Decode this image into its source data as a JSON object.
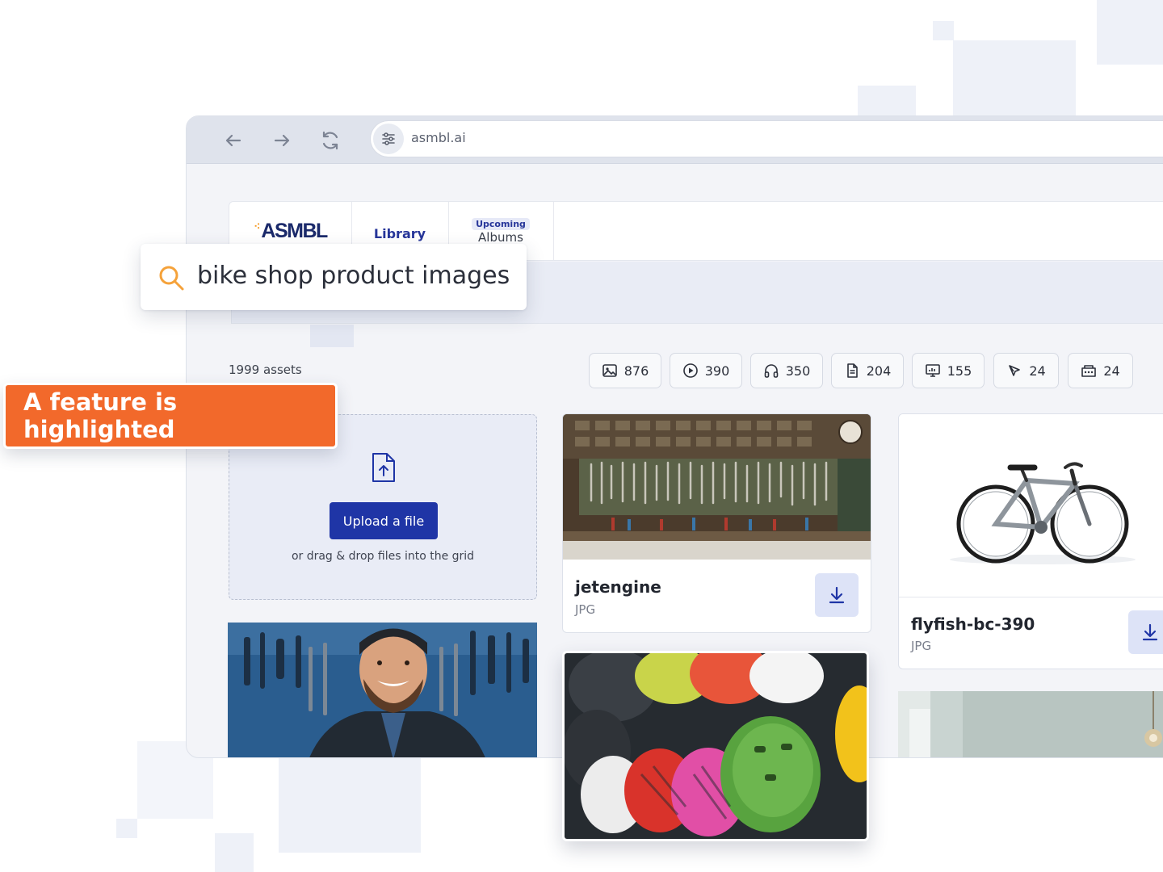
{
  "browser": {
    "url": "asmbl.ai",
    "nav_icons": [
      "back-arrow-icon",
      "forward-arrow-icon",
      "reload-icon",
      "site-settings-icon"
    ]
  },
  "app": {
    "logo": "ASMBL",
    "nav": {
      "library": "Library",
      "upcoming_badge": "Upcoming",
      "albums": "Albums"
    }
  },
  "search": {
    "query": "bike shop product images"
  },
  "assets": {
    "count_label": "1999 assets"
  },
  "filters": [
    {
      "icon": "image-icon",
      "count": "876"
    },
    {
      "icon": "video-icon",
      "count": "390"
    },
    {
      "icon": "audio-icon",
      "count": "350"
    },
    {
      "icon": "document-icon",
      "count": "204"
    },
    {
      "icon": "presentation-icon",
      "count": "155"
    },
    {
      "icon": "vector-icon",
      "count": "24"
    },
    {
      "icon": "other-icon",
      "count": "24"
    }
  ],
  "upload": {
    "button_label": "Upload a file",
    "hint": "or drag & drop files into the grid"
  },
  "cards": [
    {
      "title": "jetengine",
      "type": "JPG"
    },
    {
      "title": "flyfish-bc-390",
      "type": "JPG"
    }
  ],
  "callout": {
    "text": "A feature is highlighted"
  },
  "colors": {
    "brand": "#1f35a6",
    "accent_orange": "#f2692b",
    "search_icon": "#f5a23a"
  }
}
